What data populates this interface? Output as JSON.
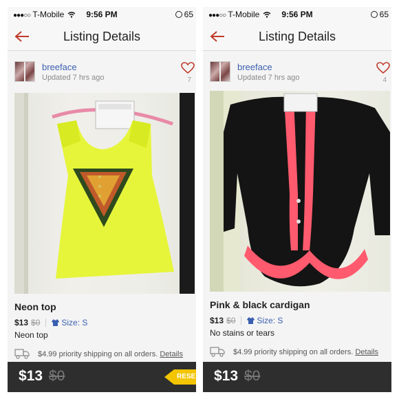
{
  "panels": [
    {
      "status": {
        "carrier": "T-Mobile",
        "time": "9:56 PM",
        "battery": "65"
      },
      "nav": {
        "title": "Listing Details"
      },
      "seller": {
        "name": "breeface",
        "updated": "Updated 7 hrs ago",
        "likes": "7"
      },
      "item": {
        "title": "Neon top",
        "price": "$13",
        "original_price": "$0",
        "size": "Size: S",
        "description": "Neon top"
      },
      "shipping": {
        "text": "$4.99 priority shipping on all orders.",
        "details": "Details"
      },
      "bottom": {
        "price": "$13",
        "original_price": "$0",
        "reserve_label": "RESE"
      }
    },
    {
      "status": {
        "carrier": "T-Mobile",
        "time": "9:56 PM",
        "battery": "65"
      },
      "nav": {
        "title": "Listing Details"
      },
      "seller": {
        "name": "breeface",
        "updated": "Updated 7 hrs ago",
        "likes": "4"
      },
      "item": {
        "title": "Pink & black cardigan",
        "price": "$13",
        "original_price": "$0",
        "size": "Size: S",
        "description": "No stains or tears"
      },
      "shipping": {
        "text": "$4.99 priority shipping on all orders.",
        "details": "Details"
      },
      "bottom": {
        "price": "$13",
        "original_price": "$0"
      }
    }
  ],
  "icons": [
    "back-arrow-icon",
    "heart-icon",
    "shirt-icon",
    "truck-icon",
    "wifi-icon",
    "lock-rotation-icon"
  ],
  "colors": {
    "accent_red": "#c0392b",
    "link_blue": "#3a5fb0",
    "bottom_bar": "#2e2e2e",
    "reserve_yellow": "#f2c500"
  }
}
